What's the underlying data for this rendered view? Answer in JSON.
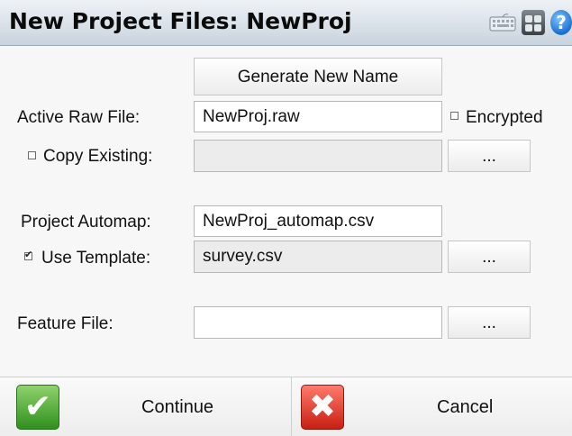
{
  "window": {
    "title": "New Project Files: NewProj"
  },
  "icons": {
    "keyboard": "keyboard-icon",
    "calculator": "calculator-icon",
    "help": "help-icon",
    "help_glyph": "?"
  },
  "form": {
    "generate_button": "Generate New Name",
    "active_raw_file": {
      "label": "Active Raw File:",
      "value": "NewProj.raw"
    },
    "encrypted": {
      "label": "Encrypted",
      "checked": false
    },
    "copy_existing": {
      "label": "Copy Existing:",
      "checked": false,
      "value": "",
      "browse": "..."
    },
    "project_automap": {
      "label": "Project Automap:",
      "value": "NewProj_automap.csv"
    },
    "use_template": {
      "label": "Use Template:",
      "checked": true,
      "value": "survey.csv",
      "browse": "..."
    },
    "feature_file": {
      "label": "Feature File:",
      "value": "",
      "browse": "..."
    }
  },
  "actions": {
    "continue": {
      "label": "Continue",
      "icon_glyph": "✔"
    },
    "cancel": {
      "label": "Cancel",
      "icon_glyph": "✖"
    }
  },
  "colors": {
    "accent_green": "#2f8f1f",
    "accent_red": "#c81e12",
    "help_blue": "#1a6fd0"
  }
}
